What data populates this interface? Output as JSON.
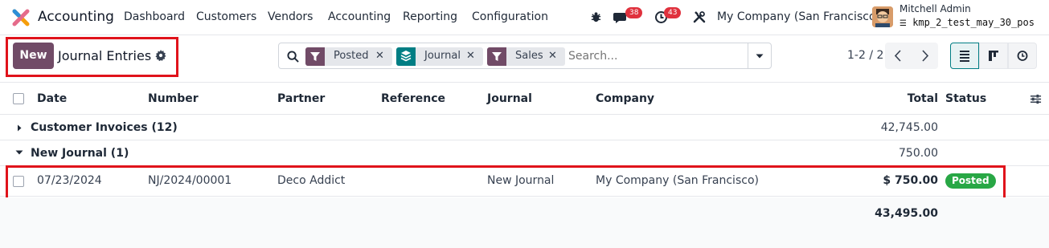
{
  "app": {
    "name": "Accounting"
  },
  "menu": [
    "Dashboard",
    "Customers",
    "Vendors",
    "Accounting",
    "Reporting",
    "Configuration"
  ],
  "systray": {
    "messages_count": "38",
    "activities_count": "43"
  },
  "company": "My Company (San Francisco)",
  "user": {
    "name": "Mitchell Admin",
    "database": "kmp_2_test_may_30_pos"
  },
  "control": {
    "new_label": "New",
    "title": "Journal Entries",
    "pager": "1-2 / 2"
  },
  "search": {
    "facets": [
      {
        "label": "Posted",
        "icon": "filter-icon",
        "color": "#714b67"
      },
      {
        "label": "Journal",
        "icon": "layers-icon",
        "color": "#017e84"
      },
      {
        "label": "Sales",
        "icon": "filter-icon",
        "color": "#714b67"
      }
    ],
    "placeholder": "Search..."
  },
  "table": {
    "columns": [
      "Date",
      "Number",
      "Partner",
      "Reference",
      "Journal",
      "Company",
      "Total",
      "Status"
    ],
    "groups": [
      {
        "label": "Customer Invoices (12)",
        "total": "42,745.00",
        "expanded": false
      },
      {
        "label": "New Journal (1)",
        "total": "750.00",
        "expanded": true
      }
    ],
    "rows": [
      {
        "date": "07/23/2024",
        "number": "NJ/2024/00001",
        "partner": "Deco Addict",
        "reference": "",
        "journal": "New Journal",
        "company": "My Company (San Francisco)",
        "total": "$ 750.00",
        "status": "Posted"
      }
    ],
    "grand_total": "43,495.00"
  },
  "colors": {
    "brand": "#714b67",
    "accent": "#017e84",
    "status_posted": "#28a745",
    "badge": "#e0313d",
    "highlight": "#e0131b"
  }
}
